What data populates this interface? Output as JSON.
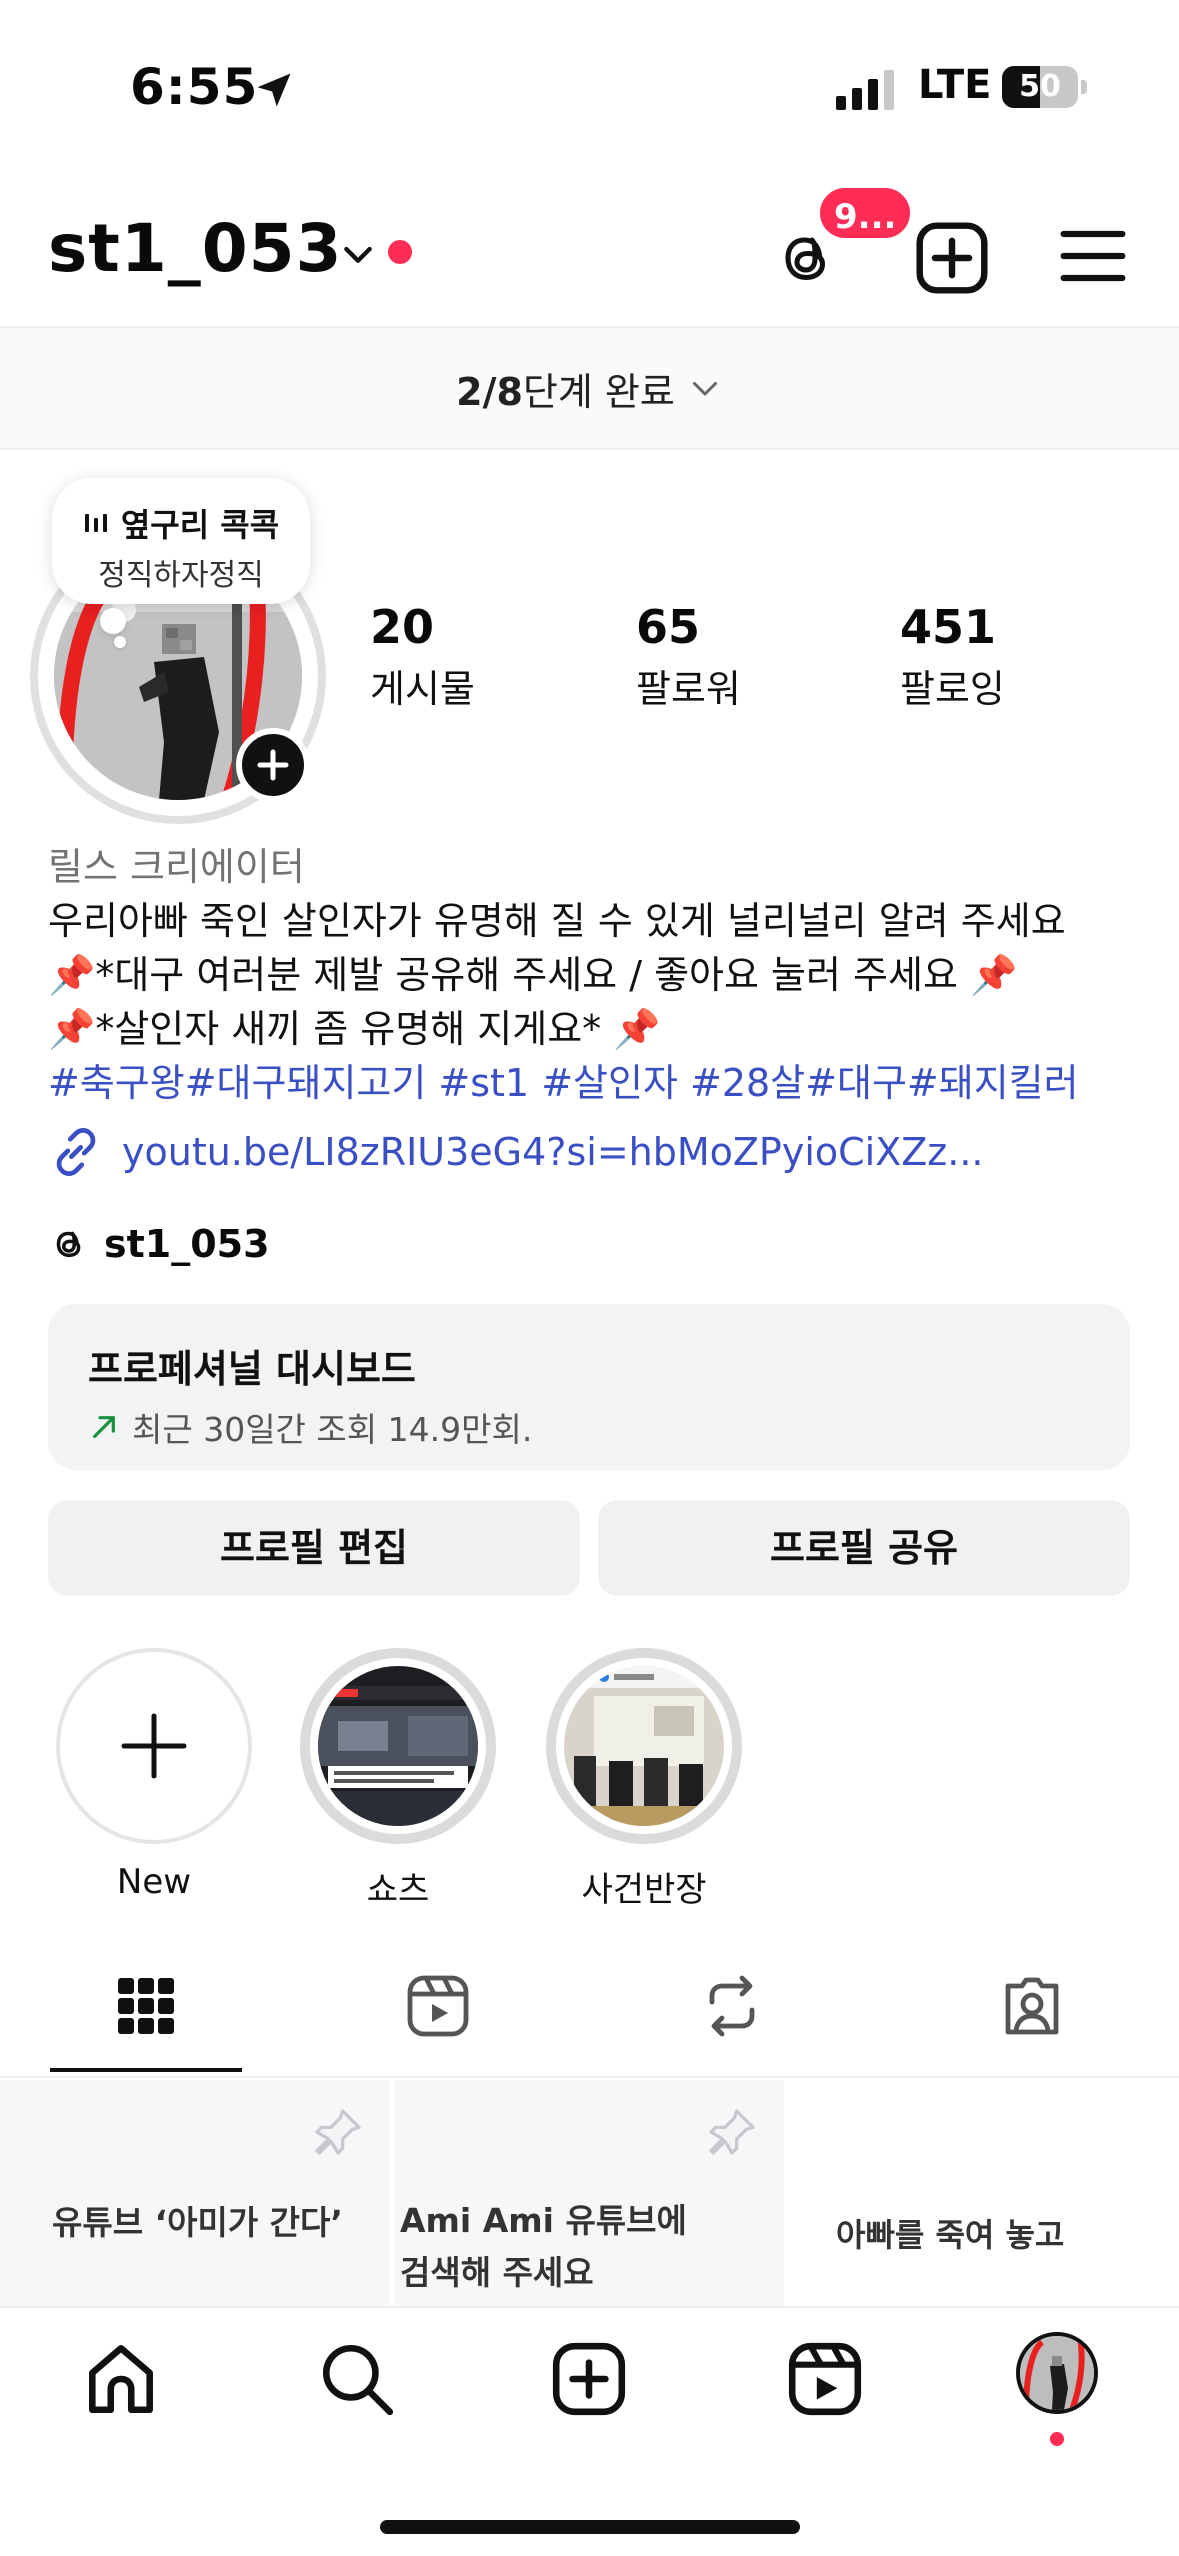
{
  "status_bar": {
    "time": "6:55",
    "network": "LTE",
    "battery_text": "50",
    "battery_level": 0.5
  },
  "header": {
    "username": "st1_053",
    "threads_badge": "9..."
  },
  "setup_progress": {
    "count": "2/8",
    "label": "단계 완료"
  },
  "note": {
    "music_label": "옆구리 콕콕",
    "text": "정직하자정직"
  },
  "stats": [
    {
      "value": "20",
      "label": "게시물"
    },
    {
      "value": "65",
      "label": "팔로워"
    },
    {
      "value": "451",
      "label": "팔로잉"
    }
  ],
  "bio": {
    "category": "릴스 크리에이터",
    "lines": [
      "우리아빠 죽인 살인자가 유명해 질 수 있게 널리널리 알려 주세요",
      "📌*대구 여러분 제발 공유해 주세요 / 좋아요 눌러 주세요 📌",
      "📌*살인자 새끼 좀 유명해 지게요* 📌"
    ],
    "hashtags": "#축구왕#대구돼지고기 #st1 #살인자 #28살#대구#돼지킬러",
    "link": "youtu.be/LI8zRIU3eG4?si=hbMoZPyioCiXZz...",
    "threads_handle": "st1_053"
  },
  "dashboard": {
    "title": "프로페셔널 대시보드",
    "subtitle": "최근 30일간 조회 14.9만회."
  },
  "buttons": {
    "edit_profile": "프로필 편집",
    "share_profile": "프로필 공유"
  },
  "highlights": [
    {
      "label": "New",
      "icon": "plus-icon"
    },
    {
      "label": "쇼츠"
    },
    {
      "label": "사건반장"
    }
  ],
  "tabs": [
    {
      "name": "grid",
      "icon": "grid-icon",
      "active": true
    },
    {
      "name": "reels",
      "icon": "reels-icon"
    },
    {
      "name": "reposts",
      "icon": "repost-icon"
    },
    {
      "name": "tagged",
      "icon": "tagged-icon"
    }
  ],
  "posts": [
    {
      "text": "유튜브 ‘아미가 간다’",
      "pinned": true
    },
    {
      "text": "Ami Ami  유튜브에",
      "text2": "검색해 주세요",
      "pinned": true
    },
    {
      "text": "아빠를 죽여 놓고",
      "pinned": false
    }
  ],
  "colors": {
    "accent_red": "#ff2d55",
    "link_blue": "#3b4fc4",
    "trend_green": "#1a8f3c"
  }
}
